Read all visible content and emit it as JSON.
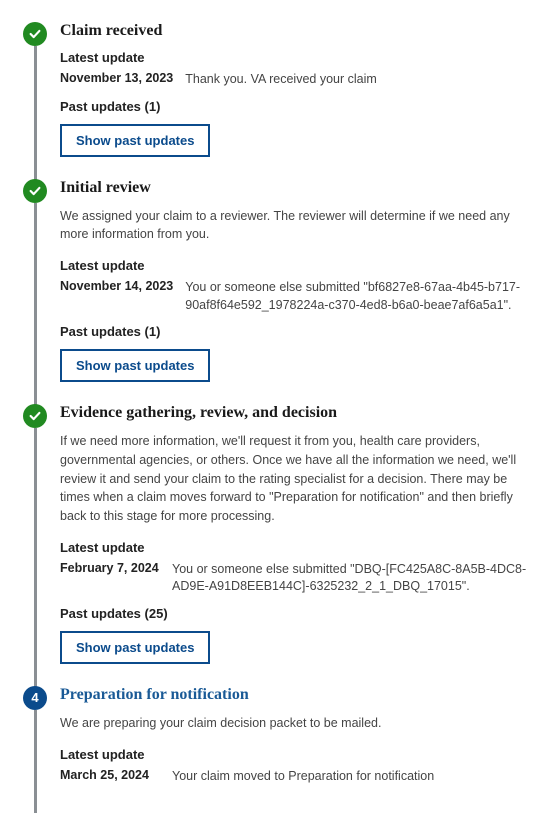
{
  "steps": [
    {
      "title": "Claim received",
      "status": "done",
      "desc": "",
      "latest_label": "Latest update",
      "latest_date": "November 13, 2023",
      "latest_text": "Thank you. VA received your claim",
      "past_label": "Past updates (1)",
      "btn": "Show past updates"
    },
    {
      "title": "Initial review",
      "status": "done",
      "desc": "We assigned your claim to a reviewer. The reviewer will determine if we need any more information from you.",
      "latest_label": "Latest update",
      "latest_date": "November 14, 2023",
      "latest_text": "You or someone else submitted \"bf6827e8-67aa-4b45-b717-90af8f64e592_1978224a-c370-4ed8-b6a0-beae7af6a5a1\".",
      "past_label": "Past updates (1)",
      "btn": "Show past updates"
    },
    {
      "title": "Evidence gathering, review, and decision",
      "status": "done",
      "desc": "If we need more information, we'll request it from you, health care providers, governmental agencies, or others. Once we have all the information we need, we'll review it and send your claim to the rating specialist for a decision. There may be times when a claim moves forward to \"Preparation for notification\" and then briefly back to this stage for more processing.",
      "latest_label": "Latest update",
      "latest_date": "February 7, 2024",
      "latest_text": "You or someone else submitted \"DBQ-[FC425A8C-8A5B-4DC8-AD9E-A91D8EEB144C]-6325232_2_1_DBQ_17015\".",
      "past_label": "Past updates (25)",
      "btn": "Show past updates"
    },
    {
      "title": "Preparation for notification",
      "status": "current",
      "number": "4",
      "desc": "We are preparing your claim decision packet to be mailed.",
      "latest_label": "Latest update",
      "latest_date": "March 25, 2024",
      "latest_text": "Your claim moved to Preparation for notification",
      "past_label": "",
      "btn": ""
    }
  ]
}
